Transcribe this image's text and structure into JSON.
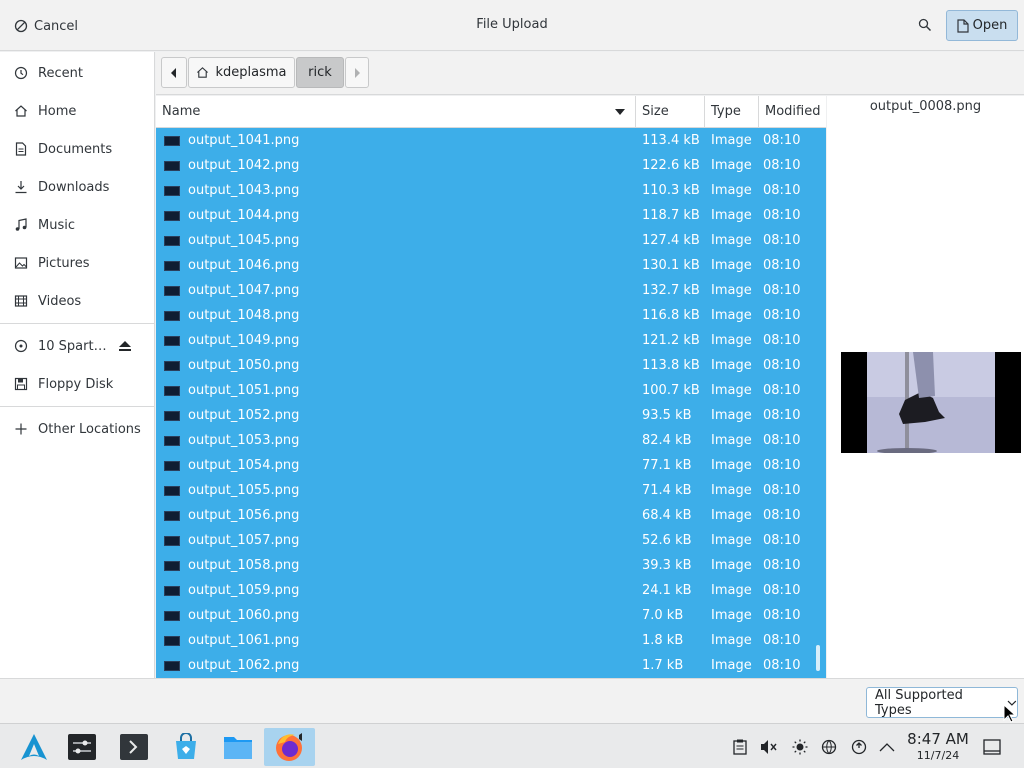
{
  "header": {
    "cancel_label": "Cancel",
    "title": "File Upload",
    "open_label": "Open"
  },
  "sidebar": {
    "items": [
      {
        "label": "Recent",
        "icon": "clock-icon"
      },
      {
        "label": "Home",
        "icon": "home-icon"
      },
      {
        "label": "Documents",
        "icon": "document-icon"
      },
      {
        "label": "Downloads",
        "icon": "download-icon"
      },
      {
        "label": "Music",
        "icon": "music-icon"
      },
      {
        "label": "Pictures",
        "icon": "picture-icon"
      },
      {
        "label": "Videos",
        "icon": "video-icon"
      }
    ],
    "devices": [
      {
        "label": "10 Spart…",
        "icon": "drive-icon"
      },
      {
        "label": "Floppy Disk",
        "icon": "floppy-icon"
      }
    ],
    "other": {
      "label": "Other Locations",
      "icon": "plus-icon"
    }
  },
  "pathbar": {
    "crumbs": [
      "kdeplasma",
      "rick"
    ]
  },
  "columns": {
    "name": "Name",
    "size": "Size",
    "type": "Type",
    "modified": "Modified"
  },
  "files": [
    {
      "name": "output_1041.png",
      "size": "113.4 kB",
      "type": "Image",
      "modified": "08:10"
    },
    {
      "name": "output_1042.png",
      "size": "122.6 kB",
      "type": "Image",
      "modified": "08:10"
    },
    {
      "name": "output_1043.png",
      "size": "110.3 kB",
      "type": "Image",
      "modified": "08:10"
    },
    {
      "name": "output_1044.png",
      "size": "118.7 kB",
      "type": "Image",
      "modified": "08:10"
    },
    {
      "name": "output_1045.png",
      "size": "127.4 kB",
      "type": "Image",
      "modified": "08:10"
    },
    {
      "name": "output_1046.png",
      "size": "130.1 kB",
      "type": "Image",
      "modified": "08:10"
    },
    {
      "name": "output_1047.png",
      "size": "132.7 kB",
      "type": "Image",
      "modified": "08:10"
    },
    {
      "name": "output_1048.png",
      "size": "116.8 kB",
      "type": "Image",
      "modified": "08:10"
    },
    {
      "name": "output_1049.png",
      "size": "121.2 kB",
      "type": "Image",
      "modified": "08:10"
    },
    {
      "name": "output_1050.png",
      "size": "113.8 kB",
      "type": "Image",
      "modified": "08:10"
    },
    {
      "name": "output_1051.png",
      "size": "100.7 kB",
      "type": "Image",
      "modified": "08:10"
    },
    {
      "name": "output_1052.png",
      "size": "93.5 kB",
      "type": "Image",
      "modified": "08:10"
    },
    {
      "name": "output_1053.png",
      "size": "82.4 kB",
      "type": "Image",
      "modified": "08:10"
    },
    {
      "name": "output_1054.png",
      "size": "77.1 kB",
      "type": "Image",
      "modified": "08:10"
    },
    {
      "name": "output_1055.png",
      "size": "71.4 kB",
      "type": "Image",
      "modified": "08:10"
    },
    {
      "name": "output_1056.png",
      "size": "68.4 kB",
      "type": "Image",
      "modified": "08:10"
    },
    {
      "name": "output_1057.png",
      "size": "52.6 kB",
      "type": "Image",
      "modified": "08:10"
    },
    {
      "name": "output_1058.png",
      "size": "39.3 kB",
      "type": "Image",
      "modified": "08:10"
    },
    {
      "name": "output_1059.png",
      "size": "24.1 kB",
      "type": "Image",
      "modified": "08:10"
    },
    {
      "name": "output_1060.png",
      "size": "7.0 kB",
      "type": "Image",
      "modified": "08:10"
    },
    {
      "name": "output_1061.png",
      "size": "1.8 kB",
      "type": "Image",
      "modified": "08:10"
    },
    {
      "name": "output_1062.png",
      "size": "1.7 kB",
      "type": "Image",
      "modified": "08:10"
    }
  ],
  "preview": {
    "filename": "output_0008.png"
  },
  "filter": {
    "selected": "All Supported Types"
  },
  "taskbar": {
    "apps": [
      "app-launcher-icon",
      "system-settings-icon",
      "terminal-icon",
      "discover-store-icon",
      "file-manager-icon",
      "firefox-icon"
    ],
    "tray": [
      "clipboard-icon",
      "volume-muted-icon",
      "brightness-icon",
      "network-icon",
      "updates-icon",
      "tray-expand-icon"
    ],
    "time": "8:47 AM",
    "date": "11/7/24"
  },
  "colors": {
    "selection": "#3daee9",
    "accent_button": "#c9deef"
  }
}
